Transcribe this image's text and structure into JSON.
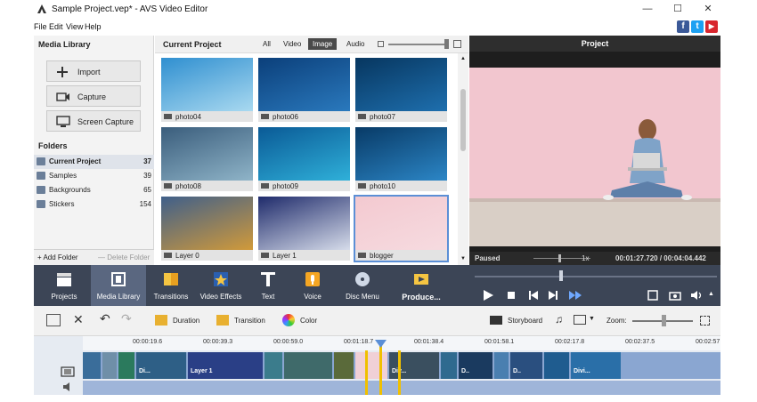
{
  "window": {
    "title": "Sample Project.vep* - AVS Video Editor",
    "minimize": "—",
    "maximize": "☐",
    "close": "✕"
  },
  "menu": [
    "File",
    "Edit",
    "View",
    "Help"
  ],
  "social": {
    "facebook": "f",
    "twitter": "t",
    "youtube": "▶"
  },
  "media_library": {
    "title": "Media Library",
    "buttons": [
      "Import",
      "Capture",
      "Screen Capture"
    ],
    "folders_title": "Folders",
    "folders": [
      {
        "name": "Current Project",
        "count": "37"
      },
      {
        "name": "Samples",
        "count": "39"
      },
      {
        "name": "Backgrounds",
        "count": "65"
      },
      {
        "name": "Stickers",
        "count": "154"
      }
    ],
    "add_folder": "+ Add Folder",
    "delete_folder": "— Delete Folder"
  },
  "current_project": {
    "title": "Current Project",
    "filters": [
      "All",
      "Video",
      "Image",
      "Audio"
    ],
    "active_filter": "Image",
    "thumbnails": [
      {
        "label": "photo04",
        "c1": "#2f8fd0",
        "c2": "#a9d9f0"
      },
      {
        "label": "photo06",
        "c1": "#0b3f7a",
        "c2": "#2a79bd"
      },
      {
        "label": "photo07",
        "c1": "#07365f",
        "c2": "#1e6fae"
      },
      {
        "label": "photo08",
        "c1": "#3a5d7c",
        "c2": "#8fb4c8"
      },
      {
        "label": "photo09",
        "c1": "#0a5a96",
        "c2": "#2fb0d9"
      },
      {
        "label": "photo10",
        "c1": "#083a66",
        "c2": "#2c86c6"
      },
      {
        "label": "Layer 0",
        "c1": "#3f5f8a",
        "c2": "#d19a3a"
      },
      {
        "label": "Layer 1",
        "c1": "#1f2b6b",
        "c2": "#d6dcea"
      },
      {
        "label": "blogger",
        "c1": "#f3c9d0",
        "c2": "#f6dbe0"
      }
    ]
  },
  "preview": {
    "title": "Project",
    "status": "Paused",
    "speed": "1x",
    "time": "00:01:27.720 / 00:04:04.442"
  },
  "toolbar": {
    "tools": [
      "Projects",
      "Media Library",
      "Transitions",
      "Video Effects",
      "Text",
      "Voice",
      "Disc Menu",
      "Produce..."
    ]
  },
  "editbar": {
    "duration": "Duration",
    "transition": "Transition",
    "color": "Color",
    "storyboard": "Storyboard",
    "zoom": "Zoom:"
  },
  "timeline": {
    "ticks": [
      "00:00:19.6",
      "00:00:39.3",
      "00:00:59.0",
      "00:01:18.7",
      "00:01:38.4",
      "00:01:58.1",
      "00:02:17.8",
      "00:02:37.5",
      "00:02:57"
    ],
    "clips": [
      {
        "label": "",
        "color": "#3a6d9a"
      },
      {
        "label": "",
        "color": "#6f8fa8"
      },
      {
        "label": "",
        "color": "#2b7a5d"
      },
      {
        "label": "Di...",
        "color": "#2e5f86"
      },
      {
        "label": "Layer 1",
        "color": "#2a3f86"
      },
      {
        "label": "",
        "color": "#3b7c8c"
      },
      {
        "label": "",
        "color": "#3f6a6a"
      },
      {
        "label": "",
        "color": "#5a6a3a"
      },
      {
        "label": "",
        "color": "#f0d0d6"
      },
      {
        "label": "Div...",
        "color": "#3a4f5f"
      },
      {
        "label": "",
        "color": "#2f6a8f"
      },
      {
        "label": "D..",
        "color": "#1a3a5f"
      },
      {
        "label": "",
        "color": "#4a7fb0"
      },
      {
        "label": "D..",
        "color": "#2a4f7f"
      },
      {
        "label": "",
        "color": "#1f5c8f"
      },
      {
        "label": "Divi...",
        "color": "#2a6fa8"
      }
    ]
  }
}
